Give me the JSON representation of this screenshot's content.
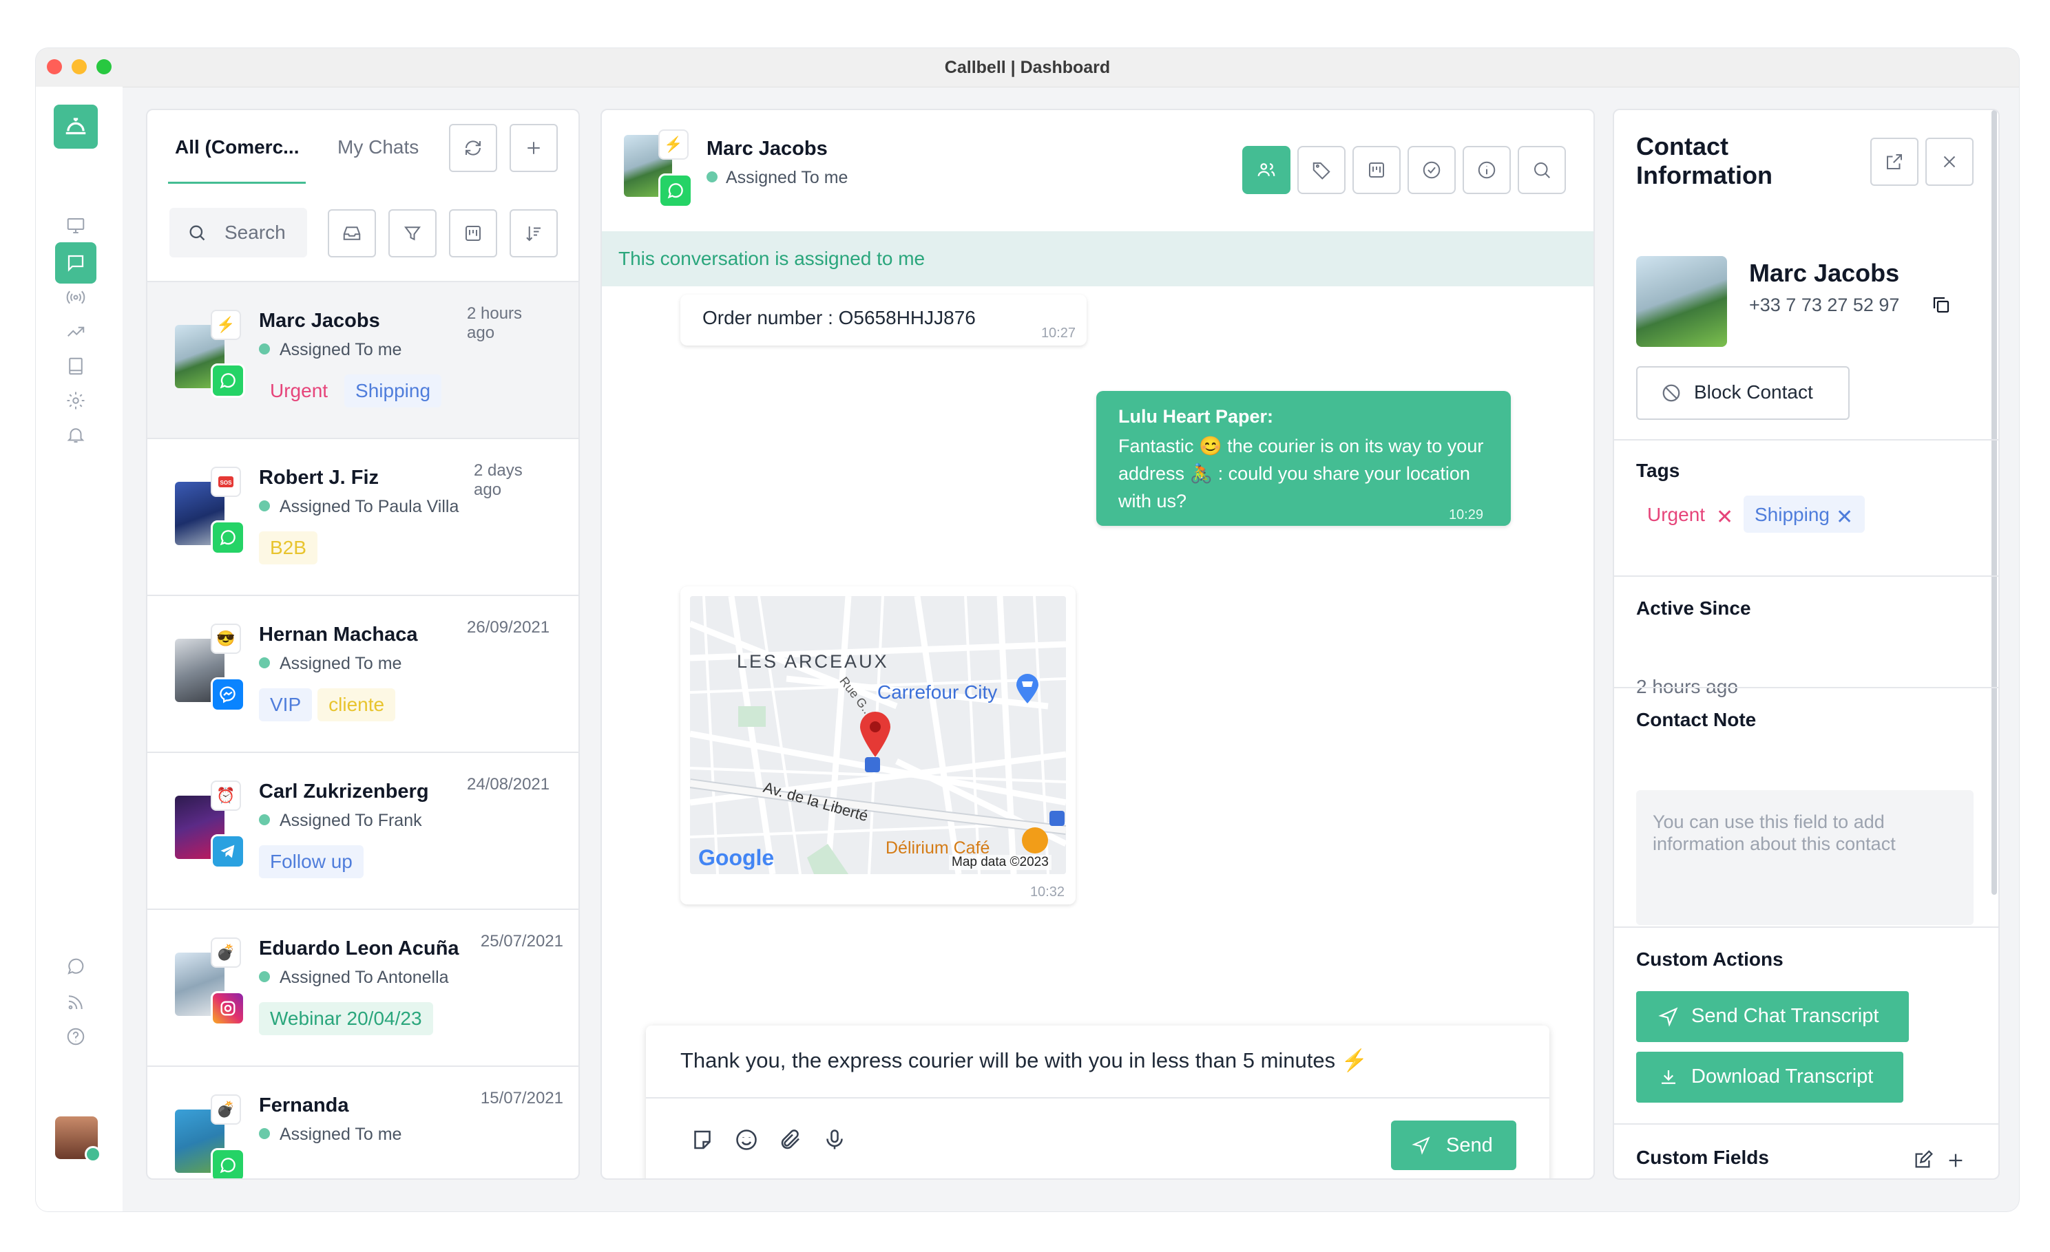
{
  "window": {
    "title": "Callbell | Dashboard"
  },
  "rail": {
    "icons": [
      "bell-logo-icon",
      "monitor-icon",
      "chat-icon",
      "broadcast-icon",
      "trending-icon",
      "book-icon",
      "gear-icon",
      "notification-icon",
      "whatsapp-icon",
      "rss-icon",
      "help-icon"
    ],
    "active": "chat-icon"
  },
  "chat_list": {
    "tabs": [
      "All (Comerc...",
      "My Chats"
    ],
    "active_tab": 0,
    "search_placeholder": "Search",
    "items": [
      {
        "name": "Marc Jacobs",
        "assigned": "Assigned To me",
        "time": "2 hours ago",
        "channel": "whatsapp",
        "tags": [
          {
            "label": "Urgent",
            "color": "red"
          },
          {
            "label": "Shipping",
            "color": "blue"
          }
        ],
        "selected": true
      },
      {
        "name": "Robert J. Fiz",
        "assigned": "Assigned To Paula Villa",
        "time": "2 days ago",
        "channel": "whatsapp",
        "tags": [
          {
            "label": "B2B",
            "color": "yellow"
          }
        ]
      },
      {
        "name": "Hernan Machaca",
        "assigned": "Assigned To me",
        "time": "26/09/2021",
        "channel": "messenger",
        "tags": [
          {
            "label": "VIP",
            "color": "blue"
          },
          {
            "label": "cliente",
            "color": "yellow"
          }
        ]
      },
      {
        "name": "Carl Zukrizenberg",
        "assigned": "Assigned To Frank",
        "time": "24/08/2021",
        "channel": "telegram",
        "tags": [
          {
            "label": "Follow up",
            "color": "blue"
          }
        ]
      },
      {
        "name": "Eduardo Leon Acuña",
        "assigned": "Assigned To Antonella",
        "time": "25/07/2021",
        "channel": "instagram",
        "tags": [
          {
            "label": "Webinar 20/04/23",
            "color": "green"
          }
        ]
      },
      {
        "name": "Fernanda",
        "assigned": "Assigned To me",
        "time": "15/07/2021",
        "channel": "whatsapp",
        "tags": []
      }
    ]
  },
  "conversation": {
    "contact_name": "Marc Jacobs",
    "assigned": "Assigned To me",
    "banner": "This conversation is assigned to me",
    "messages": [
      {
        "text": "Order number : O5658HHJJ876",
        "time": "10:27"
      },
      {
        "sender": "Lulu Heart Paper:",
        "text": "Fantastic 😊 the courier is on its way to your address 🚴 : could you share your location with us?",
        "time": "10:29"
      },
      {
        "type": "map",
        "time": "10:32",
        "labels": {
          "district": "LES ARCEAUX",
          "store": "Carrefour City",
          "street1": "Rue G...",
          "street2": "Av. de la Liberté",
          "cafe": "Délirium Café",
          "brand": "Google",
          "attribution": "Map data ©2023"
        }
      }
    ],
    "composer_text": "Thank you, the express courier will be with you in less than 5 minutes ⚡",
    "send_label": "Send"
  },
  "contact": {
    "title": "Contact Information",
    "name": "Marc Jacobs",
    "phone": "+33 7 73 27 52 97",
    "block_label": "Block Contact",
    "tags_heading": "Tags",
    "tags": [
      {
        "label": "Urgent",
        "color": "red"
      },
      {
        "label": "Shipping",
        "color": "blue"
      }
    ],
    "active_since_heading": "Active Since",
    "active_since": "2 hours ago",
    "note_heading": "Contact Note",
    "note_placeholder": "You can use this field to add information about this contact",
    "custom_actions_heading": "Custom Actions",
    "send_transcript": "Send Chat Transcript",
    "download_transcript": "Download Transcript",
    "custom_fields_heading": "Custom Fields"
  },
  "colors": {
    "accent": "#44bd93",
    "tag_red": "#e6447a",
    "tag_blue": "#4f7ddb",
    "tag_yellow": "#e8c42e",
    "tag_green": "#2aa67c"
  }
}
